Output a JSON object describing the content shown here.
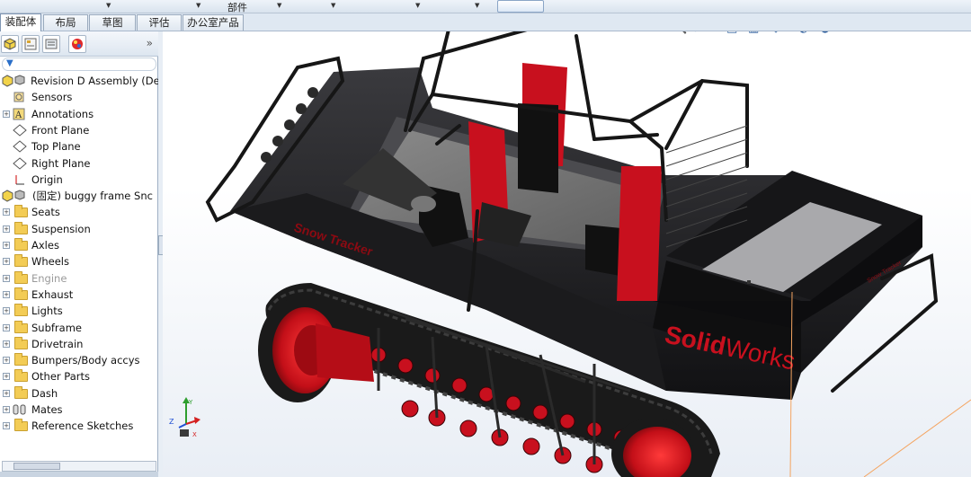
{
  "top_toolbar": {
    "parts_label": "部件"
  },
  "tabs": [
    "装配体",
    "布局",
    "草图",
    "评估",
    "办公室产品"
  ],
  "feature_tree": {
    "items": [
      {
        "label": "Revision D Assembly  (Def",
        "type": "assembly",
        "expandable": false
      },
      {
        "label": "Sensors",
        "type": "sensors"
      },
      {
        "label": "Annotations",
        "type": "annotations",
        "expandable": true
      },
      {
        "label": "Front Plane",
        "type": "plane"
      },
      {
        "label": "Top Plane",
        "type": "plane"
      },
      {
        "label": "Right Plane",
        "type": "plane"
      },
      {
        "label": "Origin",
        "type": "origin"
      },
      {
        "label": "(固定) buggy frame Snc",
        "type": "part",
        "expandable": true
      },
      {
        "label": "Seats",
        "type": "folder",
        "expandable": true
      },
      {
        "label": "Suspension",
        "type": "folder",
        "expandable": true
      },
      {
        "label": "Axles",
        "type": "folder",
        "expandable": true
      },
      {
        "label": "Wheels",
        "type": "folder",
        "expandable": true
      },
      {
        "label": "Engine",
        "type": "folder",
        "expandable": true,
        "suppressed": true
      },
      {
        "label": "Exhaust",
        "type": "folder",
        "expandable": true
      },
      {
        "label": "Lights",
        "type": "folder",
        "expandable": true
      },
      {
        "label": "Subframe",
        "type": "folder",
        "expandable": true
      },
      {
        "label": "Drivetrain",
        "type": "folder",
        "expandable": true
      },
      {
        "label": "Bumpers/Body accys",
        "type": "folder",
        "expandable": true
      },
      {
        "label": "Other Parts",
        "type": "folder",
        "expandable": true
      },
      {
        "label": "Dash",
        "type": "folder",
        "expandable": true
      },
      {
        "label": "Mates",
        "type": "mates",
        "expandable": true
      },
      {
        "label": "Reference Sketches",
        "type": "folder",
        "expandable": true
      }
    ]
  },
  "model": {
    "side_text": "Snow Tracker",
    "brand_a": "Solid",
    "brand_b": "Works",
    "rear_text": "Snow Tracker"
  },
  "colors": {
    "accent_red": "#c8101e",
    "body": "#1f1f22",
    "folder": "#f3cc55"
  }
}
